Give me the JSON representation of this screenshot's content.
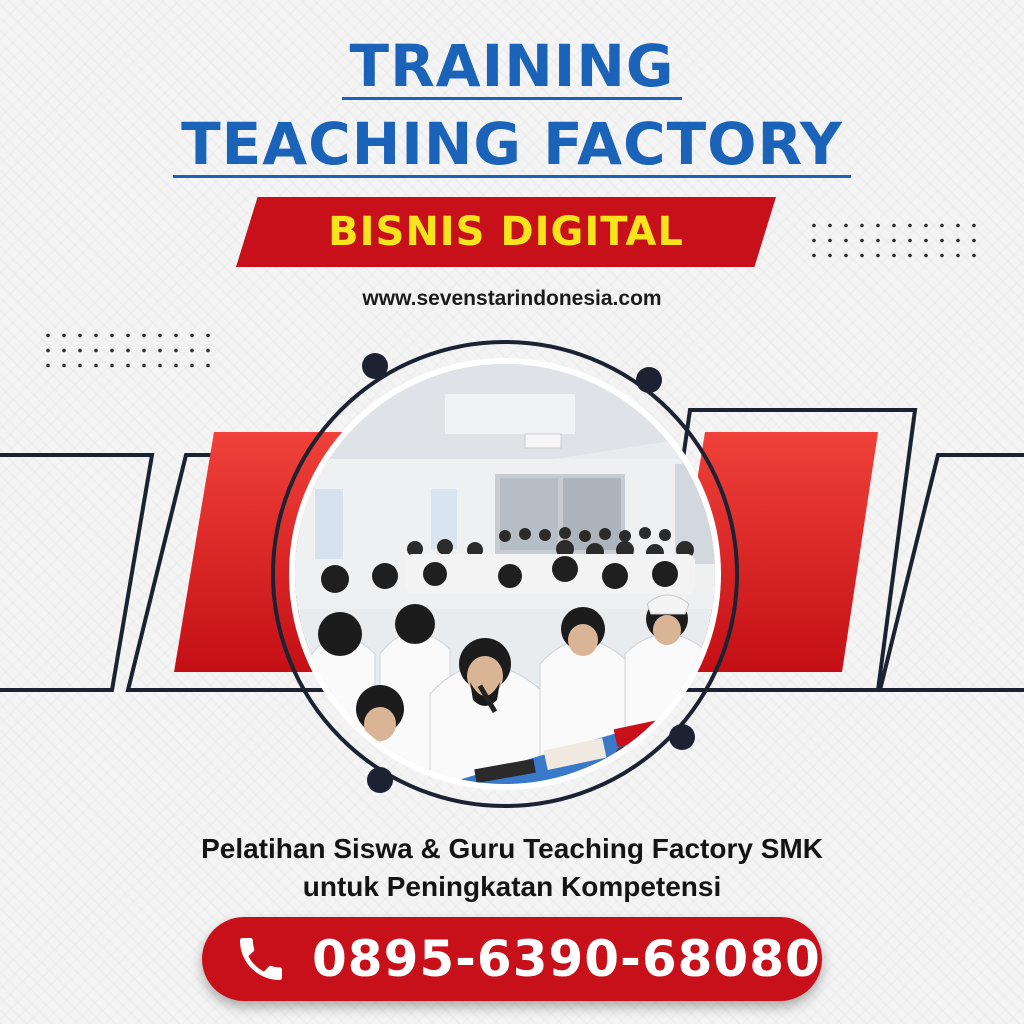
{
  "header": {
    "title_line1": "TRAINING",
    "title_line2": "TEACHING FACTORY",
    "ribbon_text": "BISNIS DIGITAL",
    "website": "www.sevenstarindonesia.com"
  },
  "photo": {
    "subject": "classroom-training-photo"
  },
  "caption": {
    "line1": "Pelatihan Siswa & Guru Teaching Factory SMK",
    "line2": "untuk Peningkatan Kompetensi"
  },
  "contact": {
    "icon": "phone-icon",
    "phone": "0895-6390-68080"
  },
  "colors": {
    "title_blue": "#1a63b8",
    "accent_red": "#c8101a",
    "ribbon_text_yellow": "#f7e41a",
    "dark_navy": "#1d2233"
  }
}
